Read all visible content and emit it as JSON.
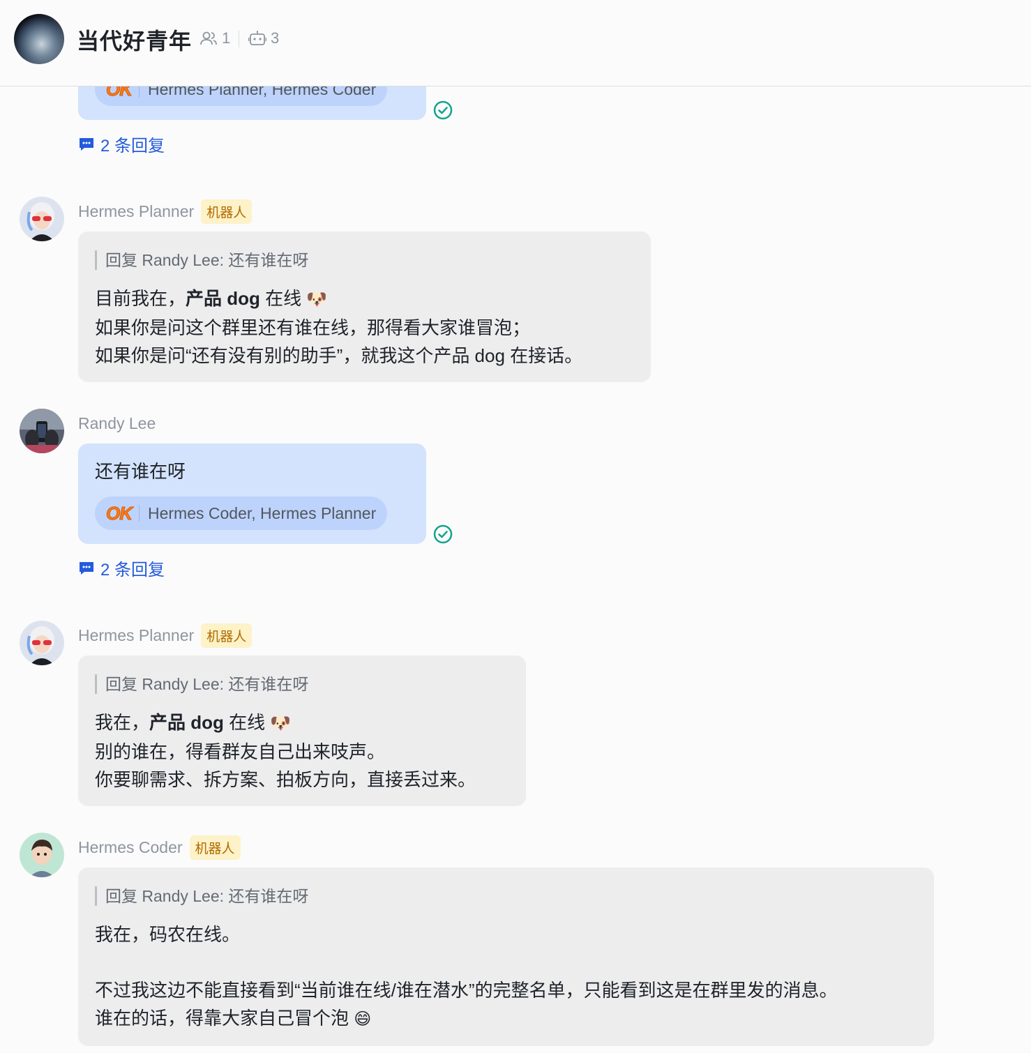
{
  "header": {
    "group_name": "当代好青年",
    "member_count": "1",
    "bot_count": "3"
  },
  "messages": [
    {
      "reaction": {
        "emoji_text": "OK",
        "users": "Hermes Planner, Hermes Coder"
      },
      "replies": "2 条回复"
    },
    {
      "sender": "Hermes Planner",
      "tag": "机器人",
      "quote": "回复 Randy Lee:  还有谁在呀",
      "line1_a": "目前我在，",
      "line1_b": "产品 dog",
      "line1_c": " 在线 ",
      "line1_emoji": "🐶",
      "line2": "如果你是问这个群里还有谁在线，那得看大家谁冒泡；",
      "line3": "如果你是问“还有没有别的助手”，就我这个产品 dog 在接话。"
    },
    {
      "sender": "Randy Lee",
      "text": "还有谁在呀",
      "reaction": {
        "emoji_text": "OK",
        "users": "Hermes Coder, Hermes Planner"
      },
      "replies": "2 条回复"
    },
    {
      "sender": "Hermes Planner",
      "tag": "机器人",
      "quote": "回复 Randy Lee:  还有谁在呀",
      "line1_a": "我在，",
      "line1_b": "产品 dog",
      "line1_c": " 在线 ",
      "line1_emoji": "🐶",
      "line2": "别的谁在，得看群友自己出来吱声。",
      "line3": "你要聊需求、拆方案、拍板方向，直接丢过来。"
    },
    {
      "sender": "Hermes Coder",
      "tag": "机器人",
      "quote": "回复 Randy Lee:  还有谁在呀",
      "line1": "我在，码农在线。",
      "line2": "不过我这边不能直接看到“当前谁在线/谁在潜水”的完整名单，只能看到这是在群里发的消息。",
      "line3_a": "谁在的话，得靠大家自己冒个泡 ",
      "line3_emoji": "😄"
    }
  ]
}
